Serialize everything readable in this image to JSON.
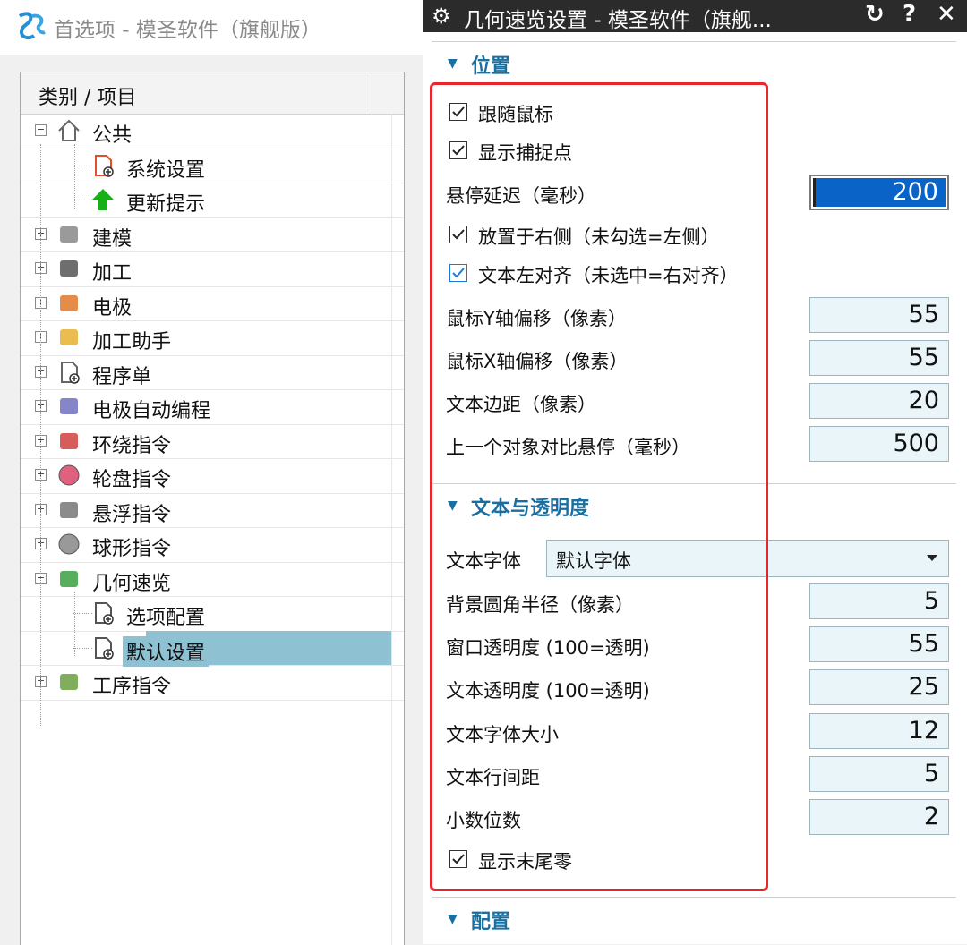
{
  "left_window": {
    "title": "首选项 - 模圣软件（旗舰版）",
    "tree_header": "类别 / 项目",
    "tree": [
      {
        "label": "公共",
        "icon": "home-icon",
        "level": 0,
        "expander": "−"
      },
      {
        "label": "系统设置",
        "icon": "settings-doc-icon",
        "level": 1
      },
      {
        "label": "更新提示",
        "icon": "green-up-arrow-icon",
        "level": 1
      },
      {
        "label": "建模",
        "icon": "modeling-icon",
        "level": 0,
        "expander": "+"
      },
      {
        "label": "加工",
        "icon": "machining-icon",
        "level": 0,
        "expander": "+"
      },
      {
        "label": "电极",
        "icon": "electrode-icon",
        "level": 0,
        "expander": "+"
      },
      {
        "label": "加工助手",
        "icon": "folder-assistant-icon",
        "level": 0,
        "expander": "+"
      },
      {
        "label": "程序单",
        "icon": "program-sheet-icon",
        "level": 0,
        "expander": "+"
      },
      {
        "label": "电极自动编程",
        "icon": "electrode-auto-icon",
        "level": 0,
        "expander": "+"
      },
      {
        "label": "环绕指令",
        "icon": "surround-icon",
        "level": 0,
        "expander": "+"
      },
      {
        "label": "轮盘指令",
        "icon": "wheel-icon",
        "level": 0,
        "expander": "+"
      },
      {
        "label": "悬浮指令",
        "icon": "float-icon",
        "level": 0,
        "expander": "+"
      },
      {
        "label": "球形指令",
        "icon": "sphere-icon",
        "level": 0,
        "expander": "+"
      },
      {
        "label": "几何速览",
        "icon": "geometry-cube-icon",
        "level": 0,
        "expander": "−"
      },
      {
        "label": "选项配置",
        "icon": "option-doc-icon",
        "level": 1
      },
      {
        "label": "默认设置",
        "icon": "default-doc-icon",
        "level": 1,
        "selected": true
      },
      {
        "label": "工序指令",
        "icon": "process-icon",
        "level": 0,
        "expander": "+"
      }
    ]
  },
  "right_window": {
    "title": "几何速览设置 - 模圣软件（旗舰...",
    "buttons": {
      "reset": "↻",
      "help": "?",
      "close": "✕"
    },
    "sections": {
      "position": "位置",
      "text_transparency": "文本与透明度",
      "config": "配置"
    },
    "position": {
      "follow_mouse": {
        "label": "跟随鼠标",
        "checked": true
      },
      "show_snap": {
        "label": "显示捕捉点",
        "checked": true
      },
      "hover_delay": {
        "label": "悬停延迟（毫秒）",
        "value": "200"
      },
      "place_right": {
        "label": "放置于右侧（未勾选=左侧）",
        "checked": true
      },
      "text_left": {
        "label": "文本左对齐（未选中=右对齐）",
        "checked": true
      },
      "y_offset": {
        "label": "鼠标Y轴偏移（像素）",
        "value": "55"
      },
      "x_offset": {
        "label": "鼠标X轴偏移（像素）",
        "value": "55"
      },
      "text_margin": {
        "label": "文本边距（像素）",
        "value": "20"
      },
      "prev_compare": {
        "label": "上一个对象对比悬停（毫秒）",
        "value": "500"
      }
    },
    "text": {
      "font": {
        "label": "文本字体",
        "value": "默认字体"
      },
      "radius": {
        "label": "背景圆角半径（像素）",
        "value": "5"
      },
      "win_alpha": {
        "label": "窗口透明度 (100=透明)",
        "value": "55"
      },
      "text_alpha": {
        "label": "文本透明度 (100=透明)",
        "value": "25"
      },
      "font_size": {
        "label": "文本字体大小",
        "value": "12"
      },
      "line_spacing": {
        "label": "文本行间距",
        "value": "5"
      },
      "decimals": {
        "label": "小数位数",
        "value": "2"
      },
      "trailing_zero": {
        "label": "显示末尾零",
        "checked": true
      }
    },
    "colors": {
      "accent": "#1a6ea0",
      "highlight_border": "#e8272d",
      "selection": "#8ec1d2",
      "input_bg": "#e9f5f8"
    }
  }
}
